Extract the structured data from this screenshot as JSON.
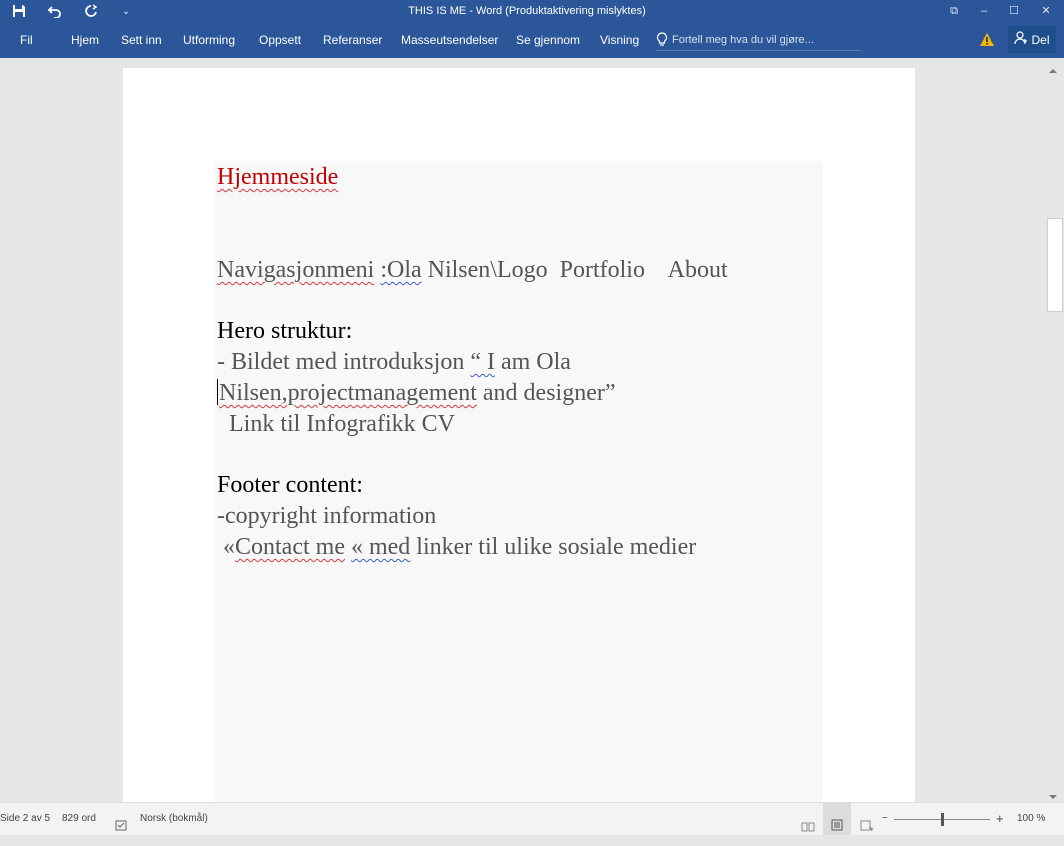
{
  "window": {
    "title": "THIS IS ME - Word (Produktaktivering mislyktes)",
    "controls": {
      "restore": "⧉",
      "minimize": "–",
      "maximize": "☐",
      "close": "✕"
    }
  },
  "qat": {
    "save_icon": "save-icon",
    "undo_icon": "undo-icon",
    "redo_icon": "redo-icon",
    "customize": "⌄"
  },
  "ribbon": {
    "tabs": [
      "Fil",
      "Hjem",
      "Sett inn",
      "Utforming",
      "Oppsett",
      "Referanser",
      "Masseutsendelser",
      "Se gjennom",
      "Visning"
    ],
    "tell_me_placeholder": "Fortell meg hva du vil gjøre...",
    "warning_icon": "warning-icon",
    "share_label": "Del"
  },
  "document": {
    "heading": "Hjemmeside",
    "nav_word1": "Navigasjonmeni",
    "nav_word2": ":Ola",
    "nav_rest": "Nilsen\\Logo  Portfolio    About",
    "hero_title": "Hero struktur:",
    "hero_line1_a": "- Bildet med introduksjon ",
    "hero_line1_b": "“ I",
    "hero_line1_c": " am Ola",
    "hero_line2_a": "Nilsen,projectmanagement",
    "hero_line2_b": " and designer”",
    "hero_line3": "  Link til Infografikk CV",
    "footer_title": "Footer content:",
    "footer_line1": "-copyright information",
    "footer_line2_a": " «",
    "footer_line2_b": "Contact me",
    "footer_line2_c": " ",
    "footer_line2_d": "« med",
    "footer_line2_e": " linker til ulike sosiale medier"
  },
  "statusbar": {
    "page": "Side 2 av 5",
    "words": "829 ord",
    "language": "Norsk (bokmål)",
    "zoom_minus": "−",
    "zoom_plus": "+",
    "zoom": "100 %",
    "zoom_percent": 100
  },
  "colors": {
    "ribbon": "#2b579a",
    "heading": "#c00000",
    "body_text": "#555555",
    "spell_error": "#d43b3b",
    "grammar_error": "#3b5fc4",
    "warning": "#f2b705"
  }
}
